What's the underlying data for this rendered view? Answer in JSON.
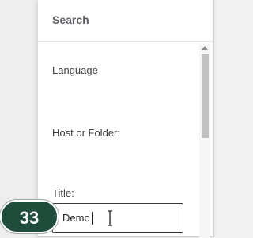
{
  "panel": {
    "title": "Search",
    "fields": {
      "language_label": "Language",
      "host_label": "Host or Folder:",
      "title_label": "Title:"
    },
    "title_input": {
      "value": "Demo"
    }
  },
  "callout": {
    "step": "33"
  },
  "colors": {
    "badge": "#1f4c3b",
    "panel": "#ffffff",
    "background": "#f2f2f2"
  },
  "icons": {
    "cursor": "text-cursor-icon",
    "scroll_up": "scroll-up-arrow-icon"
  }
}
